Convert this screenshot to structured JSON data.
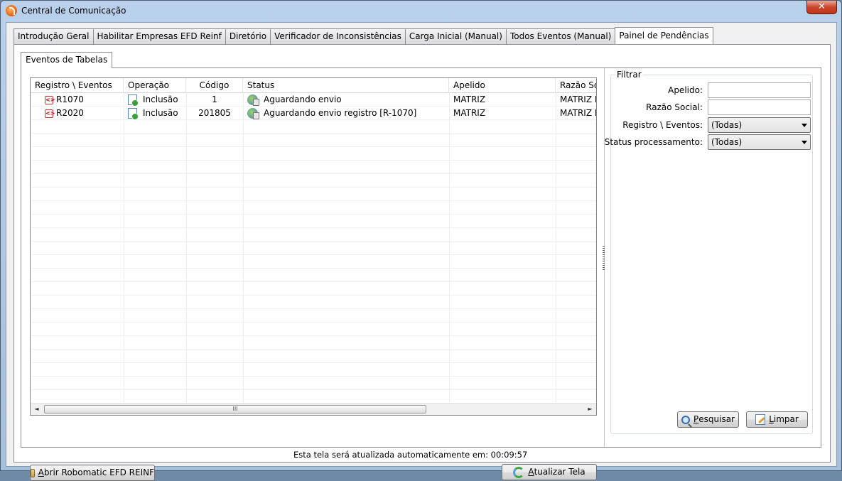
{
  "window": {
    "title": "Central de Comunicação",
    "close_glyph": "✕"
  },
  "tabs": [
    {
      "label": "Introdução Geral"
    },
    {
      "label": "Habilitar Empresas EFD Reinf"
    },
    {
      "label": "Diretório"
    },
    {
      "label": "Verificador de Inconsistências"
    },
    {
      "label": "Carga Inicial (Manual)"
    },
    {
      "label": "Todos Eventos (Manual)"
    },
    {
      "label": "Painel de Pendências"
    }
  ],
  "subtab": {
    "label": "Eventos de Tabelas"
  },
  "grid": {
    "columns": [
      "Registro \\ Eventos",
      "Operação",
      "Código",
      "Status",
      "Apelido",
      "Razão Social"
    ],
    "rows": [
      {
        "registro": "R1070",
        "operacao": "Inclusão",
        "codigo": "1",
        "status": "Aguardando envio",
        "apelido": "MATRIZ",
        "razao": "MATRIZ F"
      },
      {
        "registro": "R2020",
        "operacao": "Inclusão",
        "codigo": "201805",
        "status": "Aguardando envio registro [R-1070]",
        "apelido": "MATRIZ",
        "razao": "MATRIZ F"
      }
    ],
    "scroll": {
      "left": "◄",
      "right": "►",
      "thumb": "III"
    }
  },
  "filter": {
    "legend": "Filtrar",
    "apelido_label": "Apelido:",
    "apelido_value": "",
    "razao_label": "Razão Social:",
    "razao_value": "",
    "registro_label": "Registro \\ Eventos:",
    "registro_value": "(Todas)",
    "status_label": "Status processamento:",
    "status_value": "(Todas)"
  },
  "buttons": {
    "abrir_first": "A",
    "abrir_rest": "brir Robomatic EFD REINF",
    "atualizar_first": "A",
    "atualizar_rest": "tualizar Tela",
    "pesquisar_first": "P",
    "pesquisar_rest": "esquisar",
    "limpar_first": "L",
    "limpar_rest": "impar"
  },
  "status": {
    "auto_update": "Esta tela será atualizada automaticamente em: 00:09:57"
  }
}
